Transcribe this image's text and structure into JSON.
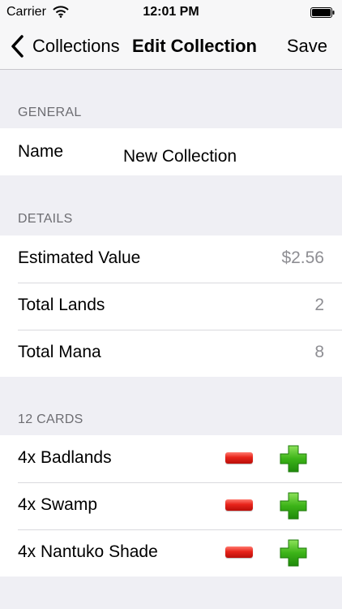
{
  "status_bar": {
    "carrier": "Carrier",
    "time": "12:01 PM"
  },
  "nav": {
    "back_label": "Collections",
    "title": "Edit Collection",
    "save_label": "Save"
  },
  "general": {
    "header": "GENERAL",
    "name_label": "Name",
    "name_value": "New Collection"
  },
  "details": {
    "header": "DETAILS",
    "rows": [
      {
        "label": "Estimated Value",
        "value": "$2.56"
      },
      {
        "label": "Total Lands",
        "value": "2"
      },
      {
        "label": "Total Mana",
        "value": "8"
      }
    ]
  },
  "cards": {
    "header": "12 CARDS",
    "items": [
      {
        "label": "4x Badlands"
      },
      {
        "label": "4x Swamp"
      },
      {
        "label": "4x Nantuko Shade"
      }
    ]
  },
  "colors": {
    "minus": "#e8231a",
    "plus": "#3cb318",
    "background": "#efeff4",
    "secondary_text": "#8e8e93"
  }
}
